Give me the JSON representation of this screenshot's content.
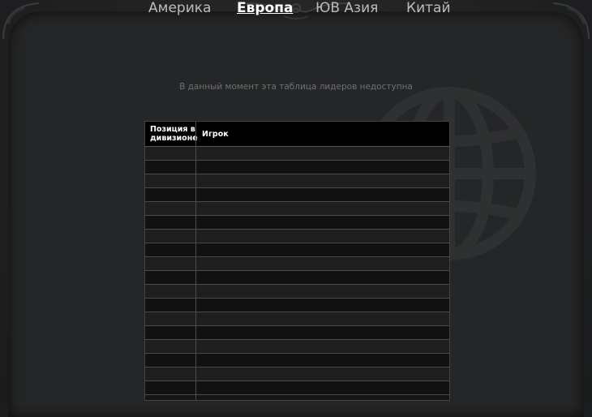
{
  "tabs": [
    {
      "label": "Америка",
      "active": false
    },
    {
      "label": "Европа",
      "active": true
    },
    {
      "label": "ЮВ Азия",
      "active": false
    },
    {
      "label": "Китай",
      "active": false
    }
  ],
  "notice": "В данный момент эта таблица лидеров недоступна",
  "table": {
    "columns": [
      "Позиция в дивизионе",
      "Игрок"
    ],
    "rows": 18
  },
  "colors": {
    "background": "#1b1c1d",
    "tab_text": "#b9bbbd",
    "tab_active": "#ffffff",
    "notice": "#6f7173",
    "header_bg": "#000000"
  },
  "icons": [
    "globe-icon",
    "ornament-icon"
  ]
}
